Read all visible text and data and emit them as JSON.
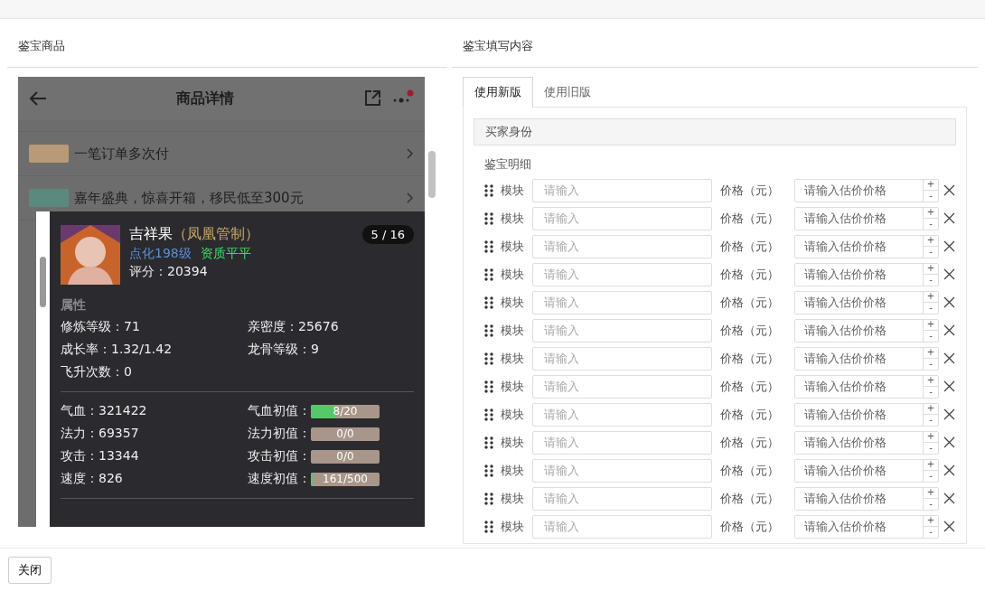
{
  "left_panel": {
    "title": "鉴宝商品",
    "screenshot": {
      "header": {
        "title": "商品详情"
      },
      "promo_rows": [
        {
          "text": "一笔订单多次付",
          "color": "#b89a78"
        },
        {
          "text": "嘉年盛典，惊喜开箱，移民低至300元",
          "color": "#5a8a7e"
        }
      ],
      "popup": {
        "name": "吉祥果",
        "note": "（凤凰管制）",
        "counter": "5 / 16",
        "level_badge": "点化198级",
        "quality_badge": "资质平平",
        "score": "评分：20394",
        "section": "属性",
        "attributes": [
          "修炼等级：71",
          "亲密度：25676",
          "成长率：1.32/1.42",
          "龙骨等级：9",
          "飞升次数：0"
        ],
        "stats": [
          {
            "value": "气血：321422",
            "label": "气血初值：",
            "reading": "8/20",
            "level": 0.35
          },
          {
            "value": "法力：69357",
            "label": "法力初值：",
            "reading": "0/0"
          },
          {
            "value": "攻击：13344",
            "label": "攻击初值：",
            "reading": "0/0"
          },
          {
            "value": "速度：826",
            "label": "速度初值：",
            "reading": "161/500",
            "level": 0.02
          }
        ]
      }
    }
  },
  "right_panel": {
    "title": "鉴宝填写内容",
    "tabs": [
      {
        "label": "使用新版",
        "selected": true
      },
      {
        "label": "使用旧版",
        "selected": false
      }
    ],
    "buyer_section": "买家身份",
    "detail_label": "鉴宝明细",
    "rows": [
      {
        "module_label": "模块",
        "module_placeholder": "请输入",
        "price_label": "价格（元）",
        "price_placeholder": "请输入估价价格",
        "plus": "+",
        "minus": "-"
      },
      {
        "module_label": "模块",
        "module_placeholder": "请输入",
        "price_label": "价格（元）",
        "price_placeholder": "请输入估价价格",
        "plus": "+",
        "minus": "-"
      },
      {
        "module_label": "模块",
        "module_placeholder": "请输入",
        "price_label": "价格（元）",
        "price_placeholder": "请输入估价价格",
        "plus": "+",
        "minus": "-"
      },
      {
        "module_label": "模块",
        "module_placeholder": "请输入",
        "price_label": "价格（元）",
        "price_placeholder": "请输入估价价格",
        "plus": "+",
        "minus": "-"
      },
      {
        "module_label": "模块",
        "module_placeholder": "请输入",
        "price_label": "价格（元）",
        "price_placeholder": "请输入估价价格",
        "plus": "+",
        "minus": "-"
      },
      {
        "module_label": "模块",
        "module_placeholder": "请输入",
        "price_label": "价格（元）",
        "price_placeholder": "请输入估价价格",
        "plus": "+",
        "minus": "-"
      },
      {
        "module_label": "模块",
        "module_placeholder": "请输入",
        "price_label": "价格（元）",
        "price_placeholder": "请输入估价价格",
        "plus": "+",
        "minus": "-"
      },
      {
        "module_label": "模块",
        "module_placeholder": "请输入",
        "price_label": "价格（元）",
        "price_placeholder": "请输入估价价格",
        "plus": "+",
        "minus": "-"
      },
      {
        "module_label": "模块",
        "module_placeholder": "请输入",
        "price_label": "价格（元）",
        "price_placeholder": "请输入估价价格",
        "plus": "+",
        "minus": "-"
      },
      {
        "module_label": "模块",
        "module_placeholder": "请输入",
        "price_label": "价格（元）",
        "price_placeholder": "请输入估价价格",
        "plus": "+",
        "minus": "-"
      },
      {
        "module_label": "模块",
        "module_placeholder": "请输入",
        "price_label": "价格（元）",
        "price_placeholder": "请输入估价价格",
        "plus": "+",
        "minus": "-"
      },
      {
        "module_label": "模块",
        "module_placeholder": "请输入",
        "price_label": "价格（元）",
        "price_placeholder": "请输入估价价格",
        "plus": "+",
        "minus": "-"
      },
      {
        "module_label": "模块",
        "module_placeholder": "请输入",
        "price_label": "价格（元）",
        "price_placeholder": "请输入估价价格",
        "plus": "+",
        "minus": "-"
      }
    ]
  },
  "footer": {
    "close_button": "关闭"
  }
}
